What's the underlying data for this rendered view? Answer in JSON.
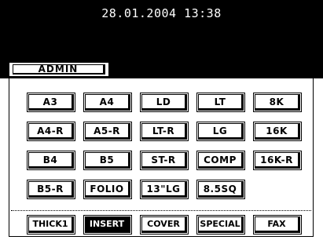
{
  "header": {
    "datetime": "28.01.2004 13:38"
  },
  "tabs": {
    "admin_label": "ADMIN"
  },
  "paper_sizes": {
    "row1": [
      "A3",
      "A4",
      "LD",
      "LT",
      "8K"
    ],
    "row2": [
      "A4-R",
      "A5-R",
      "LT-R",
      "LG",
      "16K"
    ],
    "row3": [
      "B4",
      "B5",
      "ST-R",
      "COMP",
      "16K-R"
    ],
    "row4": [
      "B5-R",
      "FOLIO",
      "13\"LG",
      "8.5SQ"
    ]
  },
  "paper_types": {
    "items": [
      "THICK1",
      "INSERT",
      "COVER",
      "SPECIAL",
      "FAX"
    ],
    "selected": "INSERT"
  },
  "colors": {
    "background": "#ffffff",
    "header": "#000000",
    "text": "#000000",
    "selected_bg": "#000000"
  }
}
